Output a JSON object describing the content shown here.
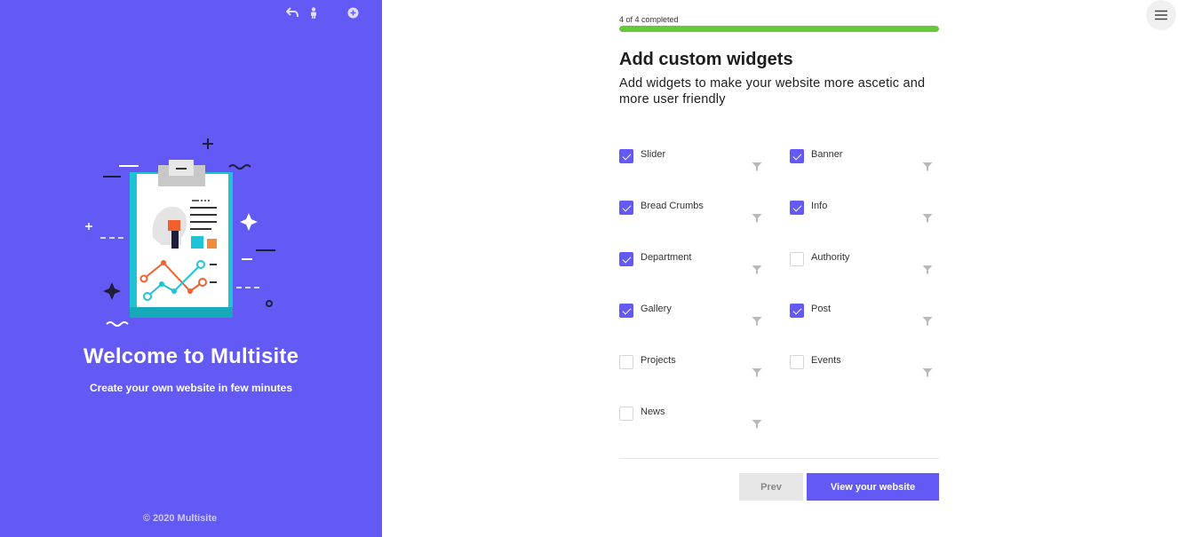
{
  "sidebar": {
    "welcome_title": "Welcome to Multisite",
    "welcome_subtitle": "Create your own website in few minutes",
    "copyright": "© 2020 Multisite",
    "background_color": "#6359f5",
    "top_icons": [
      "reply-icon",
      "person-icon",
      "plus-circle-icon"
    ]
  },
  "wizard": {
    "progress_text": "4 of 4 completed",
    "progress_fraction": 1.0,
    "progress_color": "#65c93a",
    "title": "Add custom widgets",
    "description": "Add widgets to make your website more ascetic and more user friendly",
    "widgets": [
      {
        "label": "Slider",
        "checked": true
      },
      {
        "label": "Banner",
        "checked": true
      },
      {
        "label": "Bread Crumbs",
        "checked": true
      },
      {
        "label": "Info",
        "checked": true
      },
      {
        "label": "Department",
        "checked": true
      },
      {
        "label": "Authority",
        "checked": false
      },
      {
        "label": "Gallery",
        "checked": true
      },
      {
        "label": "Post",
        "checked": true
      },
      {
        "label": "Projects",
        "checked": false
      },
      {
        "label": "Events",
        "checked": false
      },
      {
        "label": "News",
        "checked": false
      }
    ],
    "prev_label": "Prev",
    "view_label": "View your website",
    "accent_color": "#6359f5"
  },
  "header": {
    "menu_icon": "hamburger-menu-icon"
  }
}
